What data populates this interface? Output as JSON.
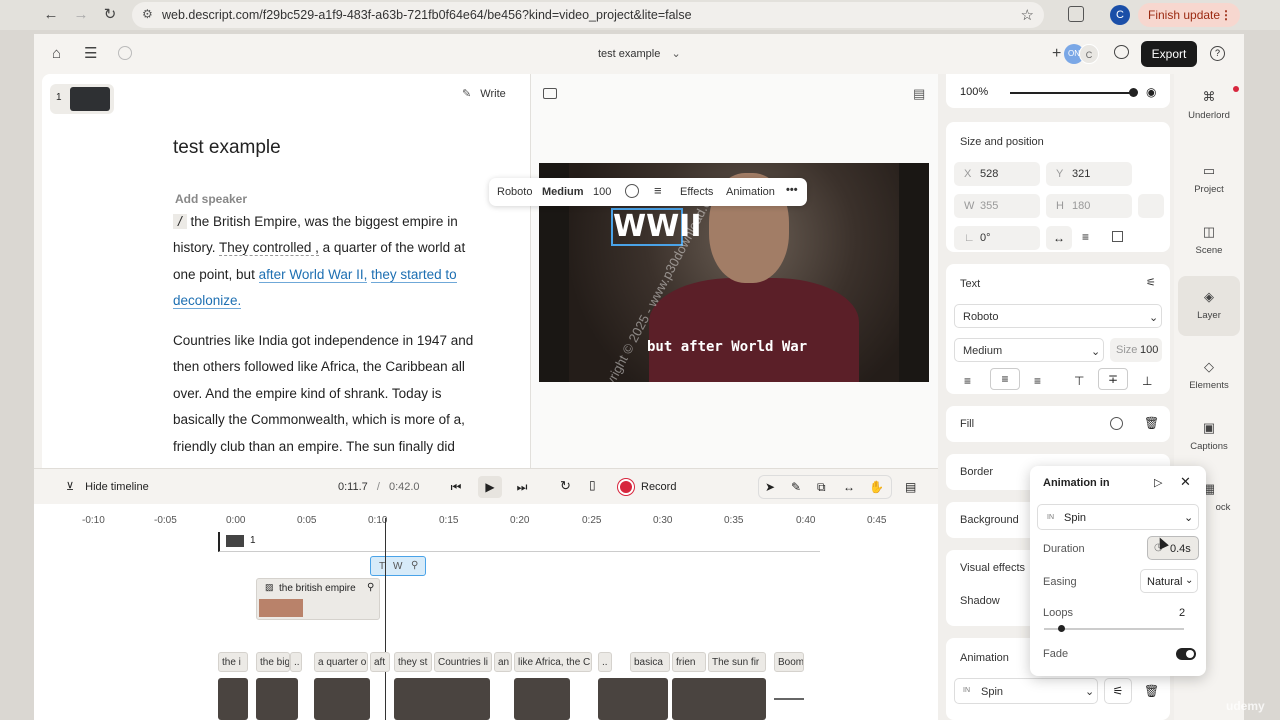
{
  "browser": {
    "url": "web.descript.com/f29bc529-a1f9-483f-a63b-721fb0f64e64/be456?kind=video_project&lite=false",
    "profile_initial": "C",
    "finish_update_label": "Finish update"
  },
  "topbar": {
    "project_title": "test example",
    "collab_initials": [
      "ON",
      "C"
    ],
    "export_label": "Export"
  },
  "script": {
    "scene_number": "1",
    "write_label": "Write",
    "doc_title": "test example",
    "add_speaker": "Add speaker",
    "para1": {
      "marker": "/",
      "s1": "the British Empire,",
      "s2": "was",
      "s3": "the biggest empire in history.",
      "s4": "They controlled ,",
      "s5": "a quarter of the world at one point, but",
      "s6_highlight": "after World War II,",
      "s7_highlight": "they started to decolonize."
    },
    "para2": {
      "l1": "Countries like India got independence in 1947 and then others followed",
      "l2": "like Africa, the Caribbean all over. And the empire kind of",
      "l3": "shrank.",
      "l4": "Today is basically the Commonwealth, which is more of a,",
      "l5": "friendly club than an empire.",
      "l6": "The sun finally did"
    }
  },
  "text_toolbar": {
    "font": "Roboto",
    "weight": "Medium",
    "size": "100",
    "effects": "Effects",
    "animation": "Animation"
  },
  "video": {
    "title_text": "WWII",
    "caption": "but after World War",
    "watermark": "Copyright © 2025 - www.p30download.com"
  },
  "properties": {
    "opacity": "100%",
    "size_position": {
      "title": "Size and position",
      "x_label": "X",
      "x": "528",
      "y_label": "Y",
      "y": "321",
      "w_label": "W",
      "w": "355",
      "h_label": "H",
      "h": "180",
      "rotation": "0°"
    },
    "text": {
      "title": "Text",
      "font": "Roboto",
      "weight": "Medium",
      "size_label": "Size",
      "size": "100"
    },
    "fill": "Fill",
    "border": "Border",
    "background": "Background",
    "visual_effects": "Visual effects",
    "shadow": "Shadow",
    "animation": {
      "title": "Animation",
      "in_badge": "IN",
      "value": "Spin"
    }
  },
  "sidenav": [
    {
      "label": "Underlord",
      "icon": "robot-icon"
    },
    {
      "label": "Project",
      "icon": "folder-icon"
    },
    {
      "label": "Scene",
      "icon": "scene-icon"
    },
    {
      "label": "Layer",
      "icon": "layers-icon"
    },
    {
      "label": "Elements",
      "icon": "shapes-icon"
    },
    {
      "label": "Captions",
      "icon": "captions-icon"
    },
    {
      "label": "ock",
      "icon": "stock-icon"
    }
  ],
  "timeline": {
    "hide_label": "Hide timeline",
    "current_time": "0:11.7",
    "separator": "/",
    "total_time": "0:42.0",
    "record_label": "Record",
    "ticks": [
      "-0:10",
      "-0:05",
      "0:00",
      "0:05",
      "0:10",
      "0:15",
      "0:20",
      "0:25",
      "0:30",
      "0:35",
      "0:40",
      "0:45"
    ],
    "scene_label": "1",
    "text_clip": [
      "T",
      "W"
    ],
    "image_clip": "the british empire",
    "word_clips": [
      "the i",
      "the big",
      "..",
      "a quarter o",
      "aft",
      "they st",
      "Countries li",
      "an",
      "like Africa, the C",
      "..",
      "basica",
      "frien",
      "The sun fir",
      "Boom"
    ]
  },
  "anim_popup": {
    "title": "Animation in",
    "in_badge": "IN",
    "type": "Spin",
    "duration_label": "Duration",
    "duration": "0.4s",
    "easing_label": "Easing",
    "easing": "Natural",
    "loops_label": "Loops",
    "loops": "2",
    "loops_level": 0.12,
    "fade_label": "Fade",
    "fade_on": true
  },
  "colors": {
    "accent": "#1d6fb2",
    "selection": "#4aa3e8",
    "record": "#d7263d",
    "finish_update_bg": "#f7d7cf"
  },
  "brand": "udemy"
}
